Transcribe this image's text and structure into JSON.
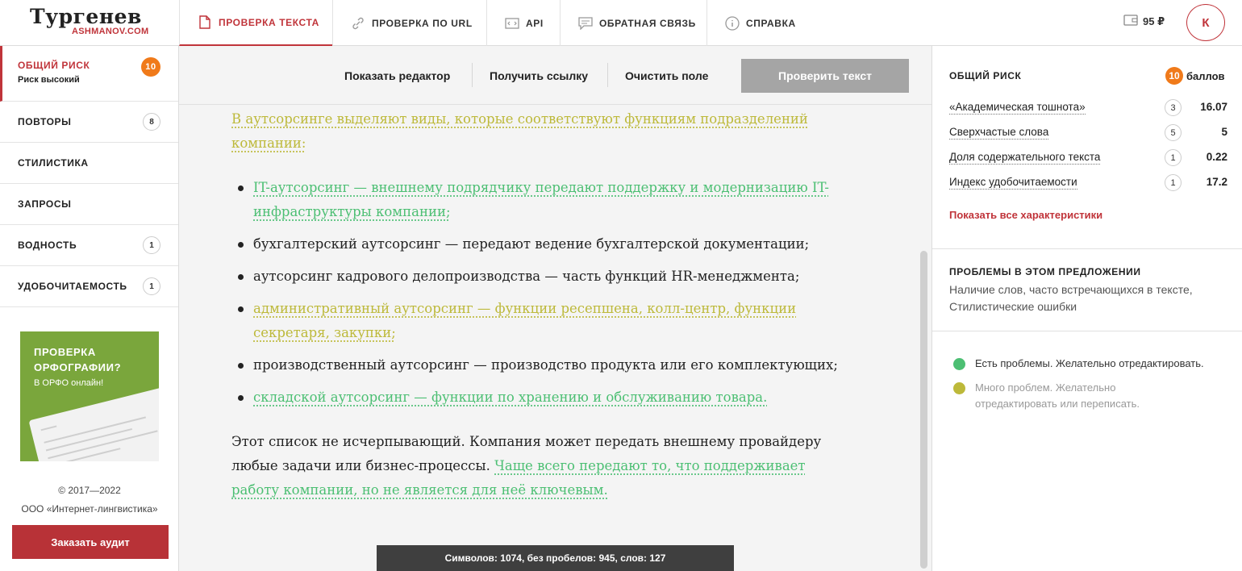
{
  "header": {
    "logo_main": "Тургенев",
    "logo_sub": "ASHMANOV.COM",
    "tabs": [
      {
        "label": "ПРОВЕРКА ТЕКСТА",
        "icon": "document-icon"
      },
      {
        "label": "ПРОВЕРКА ПО URL",
        "icon": "link-icon"
      },
      {
        "label": "API",
        "icon": "code-icon"
      },
      {
        "label": "ОБРАТНАЯ СВЯЗЬ",
        "icon": "chat-icon"
      },
      {
        "label": "СПРАВКА",
        "icon": "info-icon"
      }
    ],
    "balance": "95 ₽",
    "avatar_letter": "К"
  },
  "sidebar": {
    "risk_label": "ОБЩИЙ РИСК",
    "risk_sub": "Риск высокий",
    "risk_count": "10",
    "items": [
      {
        "label": "ПОВТОРЫ",
        "count": "8"
      },
      {
        "label": "СТИЛИСТИКА",
        "count": ""
      },
      {
        "label": "ЗАПРОСЫ",
        "count": ""
      },
      {
        "label": "ВОДНОСТЬ",
        "count": "1"
      },
      {
        "label": "УДОБОЧИТАЕМОСТЬ",
        "count": "1"
      }
    ],
    "promo_title": "ПРОВЕРКА ОРФОГРАФИИ?",
    "promo_line1": "ПРОВЕРКА",
    "promo_line2": "ОРФОГРАФИИ?",
    "promo_sub": "В ОРФО онлайн!",
    "copyright": "© 2017—2022",
    "company": "ООО «Интернет-лингвистика»",
    "audit_button": "Заказать аудит"
  },
  "toolbar": {
    "show_editor": "Показать редактор",
    "get_link": "Получить ссылку",
    "clear": "Очистить поле",
    "check": "Проверить текст"
  },
  "editor": {
    "intro": "В аутсорсинге выделяют виды, которые соответствуют функциям подразделений компании:",
    "items": [
      "IT-аутсорсинг — внешнему подрядчику передают поддержку и модернизацию IT-инфраструктуры компании;",
      "бухгалтерский аутсорсинг — передают ведение бухгалтерской документации;",
      "аутсорсинг кадрового делопроизводства — часть функций HR-менеджмента;",
      "административный аутсорсинг — функции ресепшена, колл-центр, функции секретаря, закупки;",
      "производственный аутсорсинг — производство продукта или его комплектующих;",
      "складской аутсорсинг — функции по хранению и обслуживанию товара."
    ],
    "outro_plain": "Этот список не исчерпывающий. Компания может передать внешнему провайдеру любые задачи или бизнес-процессы.",
    "outro_highlight": "Чаще всего передают то, что поддерживает работу компании, но не является для неё ключевым.",
    "counter": "Символов: 1074, без пробелов: 945, слов: 127"
  },
  "right_panel": {
    "title": "ОБЩИЙ РИСК",
    "score_value": "10",
    "score_unit": "баллов",
    "metrics": [
      {
        "name": "«Академическая тошнота»",
        "count": "3",
        "value": "16.07"
      },
      {
        "name": "Сверхчастые слова",
        "count": "5",
        "value": "5"
      },
      {
        "name": "Доля содержательного текста",
        "count": "1",
        "value": "0.22"
      },
      {
        "name": "Индекс удобочитаемости",
        "count": "1",
        "value": "17.2"
      }
    ],
    "show_all": "Показать все характеристики",
    "problems_title": "ПРОБЛЕМЫ В ЭТОМ ПРЕДЛОЖЕНИИ",
    "problems_text": "Наличие слов, часто встречающихся в тексте, Стилистические ошибки",
    "legend": [
      {
        "text": "Есть проблемы. Желательно отредактировать.",
        "color": "#4cbf73"
      },
      {
        "text": "Много проблем. Желательно отредактировать или переписать.",
        "color": "#bdb93a"
      }
    ]
  },
  "colors": {
    "accent": "#c0343a",
    "risk_badge": "#f07a1a",
    "highlight_green": "#4cbf73",
    "highlight_yellow": "#bdb93a"
  }
}
